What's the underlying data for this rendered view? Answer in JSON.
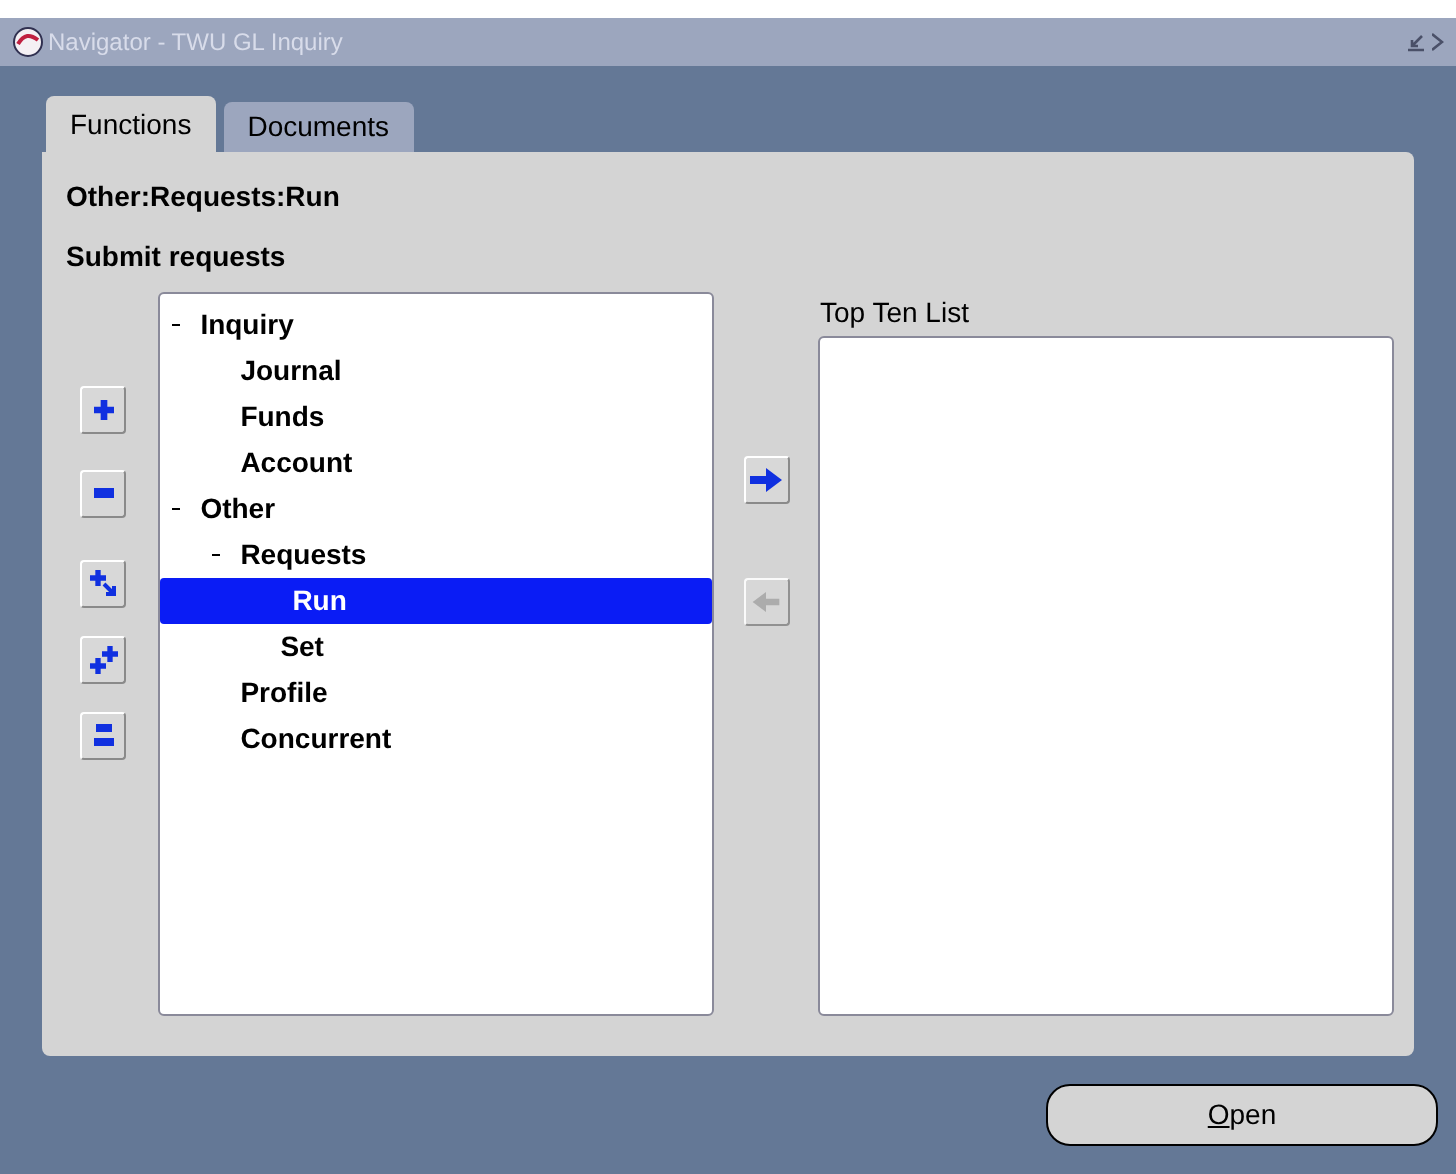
{
  "window": {
    "title": "Navigator - TWU GL Inquiry"
  },
  "tabs": [
    {
      "label": "Functions",
      "selected": true
    },
    {
      "label": "Documents",
      "selected": false
    }
  ],
  "path": "Other:Requests:Run",
  "description": "Submit requests",
  "tree_buttons": [
    {
      "kind": "expand",
      "disabled": false
    },
    {
      "kind": "collapse",
      "disabled": false
    },
    {
      "kind": "expand_branch",
      "disabled": false
    },
    {
      "kind": "expand_all",
      "disabled": false
    },
    {
      "kind": "collapse_all",
      "disabled": false
    }
  ],
  "tree": [
    {
      "label": "Inquiry",
      "expanded": true,
      "selected": false,
      "children": [
        {
          "label": "Journal",
          "selected": false
        },
        {
          "label": "Funds",
          "selected": false
        },
        {
          "label": "Account",
          "selected": false
        }
      ]
    },
    {
      "label": "Other",
      "expanded": true,
      "selected": false,
      "children": [
        {
          "label": "Requests",
          "expanded": true,
          "selected": false,
          "children": [
            {
              "label": "Run",
              "selected": true
            },
            {
              "label": "Set",
              "selected": false
            }
          ]
        },
        {
          "label": "Profile",
          "selected": false
        },
        {
          "label": "Concurrent",
          "selected": false
        }
      ]
    }
  ],
  "move_buttons": [
    {
      "kind": "add",
      "disabled": false
    },
    {
      "kind": "remove",
      "disabled": true
    }
  ],
  "top_ten": {
    "label": "Top Ten List"
  },
  "open_button": {
    "label": "Open"
  }
}
